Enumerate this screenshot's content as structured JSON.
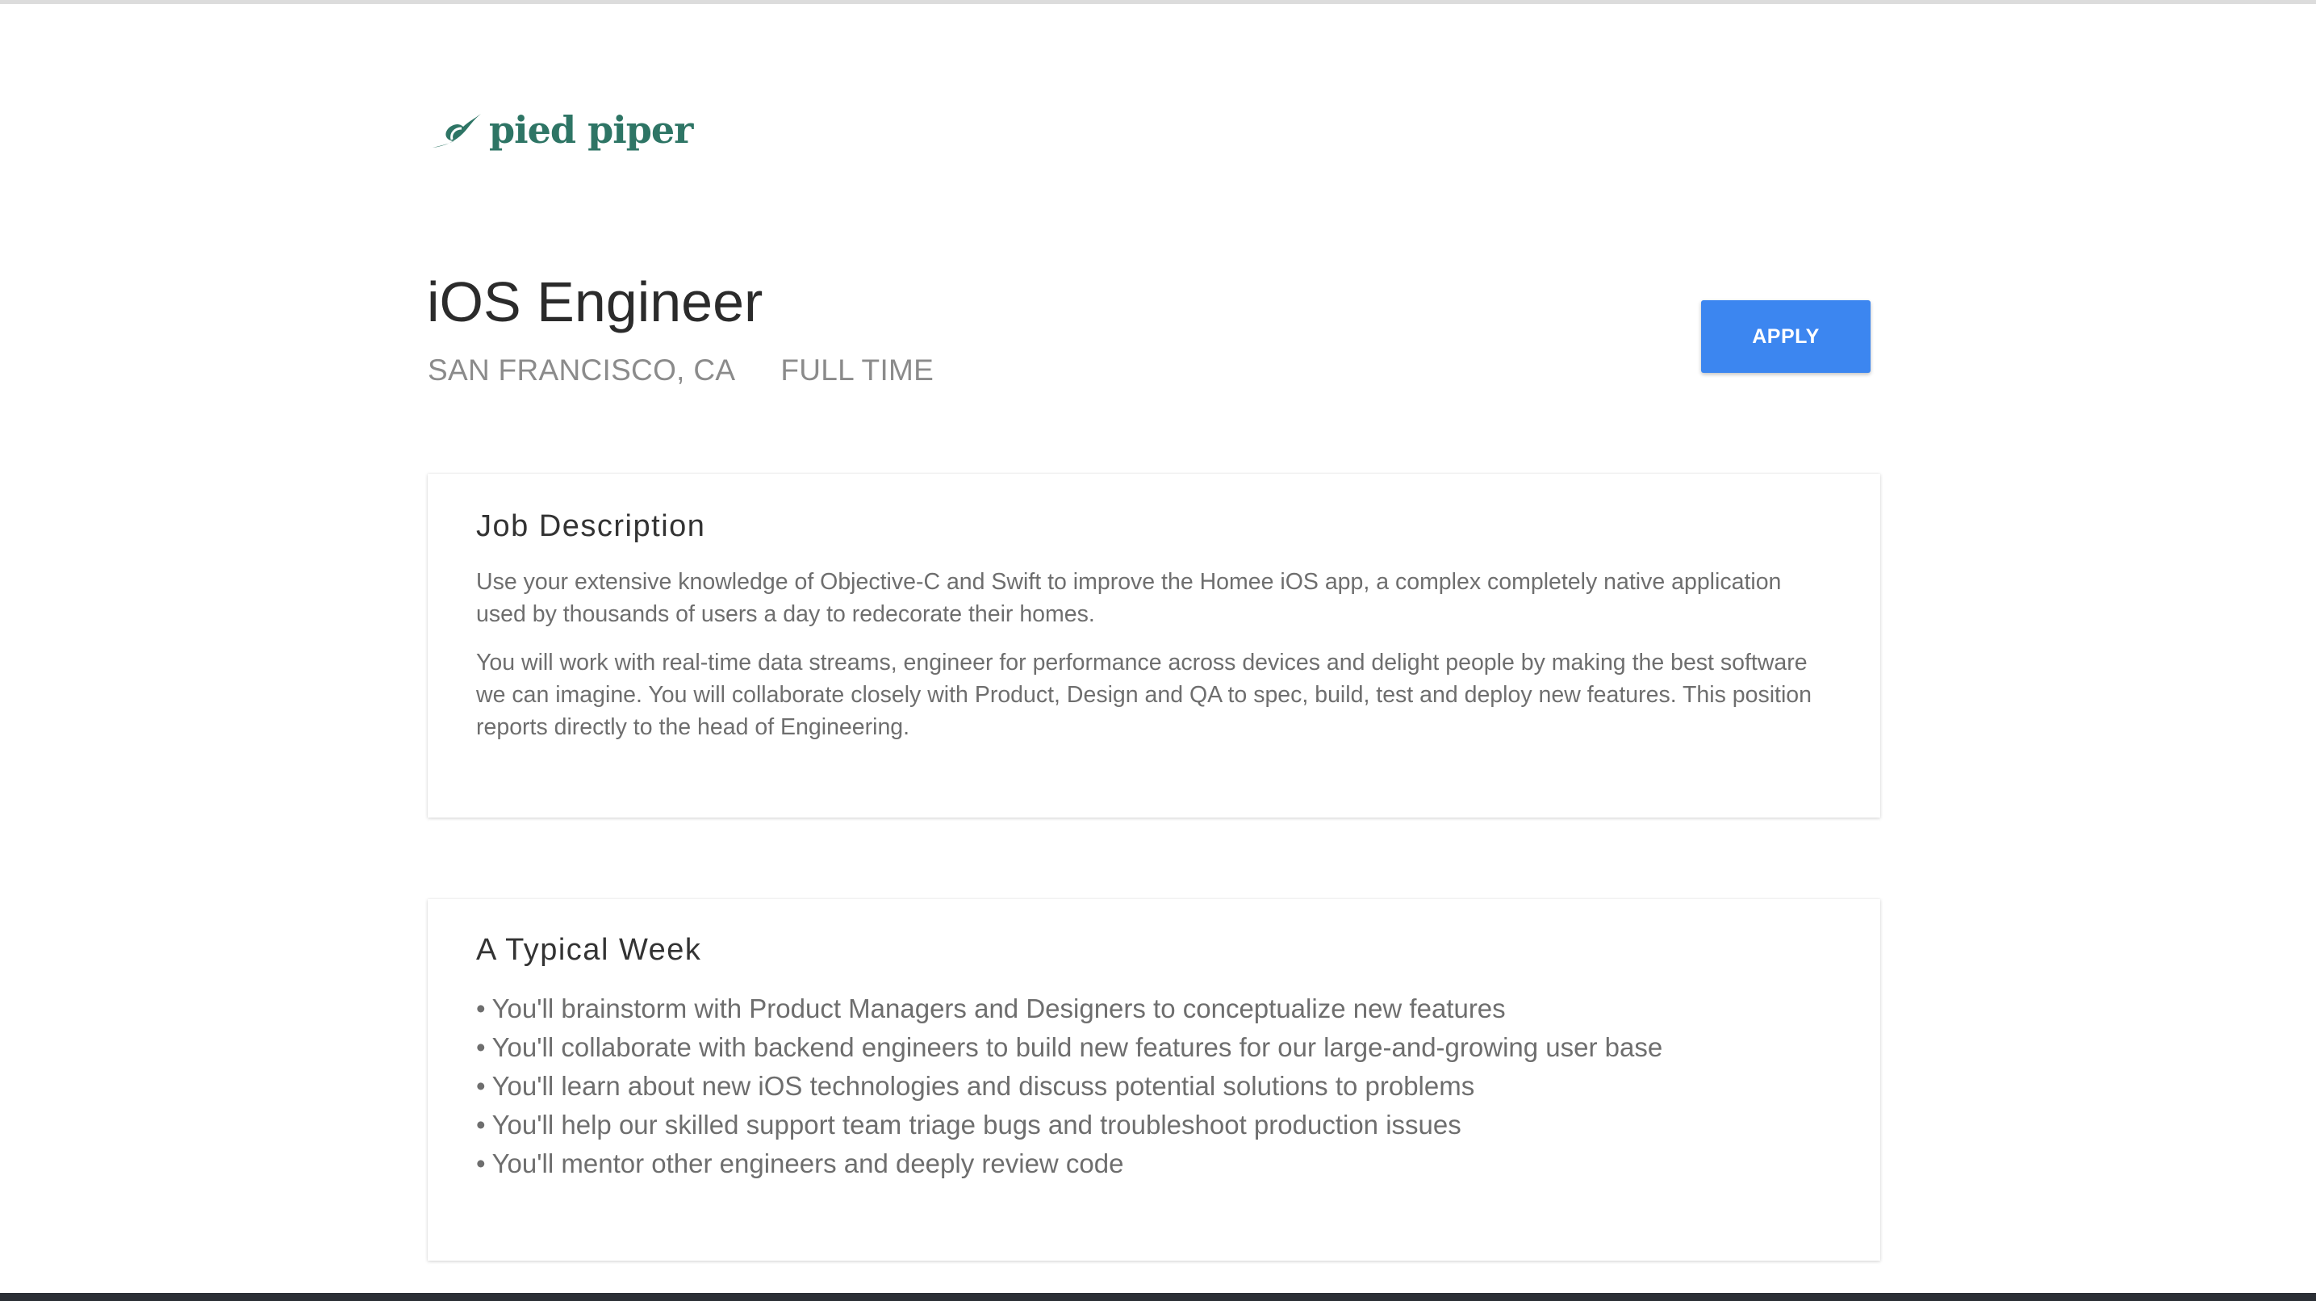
{
  "brand": {
    "name": "pied piper",
    "color": "#2e7565"
  },
  "job": {
    "title": "iOS Engineer",
    "location": "SAN FRANCISCO, CA",
    "type": "FULL TIME",
    "apply_label": "APPLY",
    "accent_color": "#3c86f0"
  },
  "sections": {
    "description": {
      "heading": "Job Description",
      "paragraphs": [
        "Use your extensive knowledge of Objective-C and Swift to improve the Homee iOS app, a complex completely native application used by thousands of users a day to redecorate their homes.",
        "You will work with real-time data streams, engineer for performance across devices and delight people by making the best software we can imagine. You will collaborate closely with Product, Design and QA to spec, build, test and deploy new features. This position reports directly to the head of Engineering."
      ]
    },
    "typical_week": {
      "heading": "A Typical Week",
      "bullet_symbol": "•",
      "items": [
        "You'll brainstorm with Product Managers and Designers to conceptualize new features",
        "You'll collaborate with backend engineers to build new features for our large-and-growing user base",
        "You'll learn about new iOS technologies and discuss potential solutions to problems",
        "You'll help our skilled support team triage bugs and troubleshoot production issues",
        "You'll mentor other engineers and deeply review code"
      ]
    }
  }
}
